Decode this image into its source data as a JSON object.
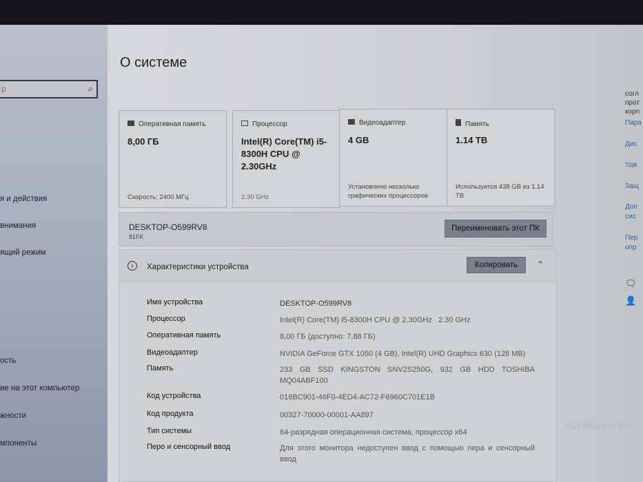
{
  "sidebar": {
    "search_placeholder": "р",
    "items": [
      "я и действия",
      "внимания",
      "ящий режим",
      "ость",
      "ие на этот компьютер",
      "жности",
      "мпоненты"
    ]
  },
  "page_title": "О системе",
  "cards": [
    {
      "label": "Оперативная память",
      "value": "8,00 ГБ",
      "sub": "Скорость: 2400 МГц"
    },
    {
      "label": "Процессор",
      "value": "Intel(R) Core(TM) i5-8300H CPU @ 2.30GHz",
      "sub": "2.30 GHz"
    },
    {
      "label": "Видеоадаптер",
      "value": "4 GB",
      "sub": "Установлено несколько графических процессоров"
    },
    {
      "label": "Память",
      "value": "1.14 TB",
      "sub": "Используется 438 GB из 1.14 TB"
    }
  ],
  "pc": {
    "name": "DESKTOP-O599RV8",
    "model": "81FK",
    "rename_label": "Переименовать этот ПК"
  },
  "specs": {
    "title": "Характеристики устройства",
    "copy_label": "Копировать",
    "rows": [
      {
        "k": "Имя устройства",
        "v": "DESKTOP-O599RV8"
      },
      {
        "k": "Процессор",
        "v": "Intel(R) Core(TM) i5-8300H CPU @ 2.30GHz   2.30 GHz"
      },
      {
        "k": "Оперативная память",
        "v": "8,00 ГБ (доступно: 7,88 ГБ)"
      },
      {
        "k": "Видеоадаптер",
        "v": "NVIDIA GeForce GTX 1050 (4 GB), Intel(R) UHD Graphics 630 (128 MB)"
      },
      {
        "k": "Память",
        "v": "233 GB SSD KINGSTON SNV2S250G, 932 GB HDD TOSHIBA MQ04ABF100"
      },
      {
        "k": "Код устройства",
        "v": "018BC901-46F0-4ED4-AC72-F6960C701E1B"
      },
      {
        "k": "Код продукта",
        "v": "00327-70000-00001-AA897"
      },
      {
        "k": "Тип системы",
        "v": "64-разрядная операционная система, процессор x64"
      },
      {
        "k": "Перо и сенсорный ввод",
        "v": "Для этого монитора недоступен ввод с помощью пера и сенсорный ввод"
      }
    ]
  },
  "right_links": [
    "согл",
    "прот",
    "корп",
    "Пара",
    "Дис",
    "Уда",
    "Защ",
    "Доп",
    "сис",
    "Пер",
    "опр"
  ],
  "watermark": "Активация Wi"
}
